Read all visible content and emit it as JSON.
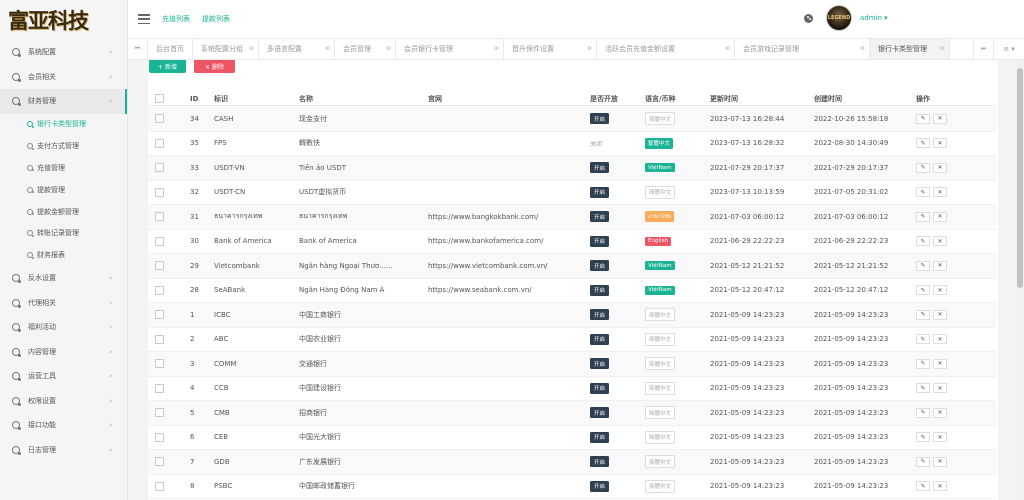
{
  "logo": {
    "text": "富亚科技"
  },
  "sidebar": {
    "items": [
      {
        "label": "系统配置",
        "open": false
      },
      {
        "label": "会员相关",
        "open": false
      },
      {
        "label": "财务管理",
        "open": true,
        "children": [
          {
            "label": "银行卡类型管理",
            "active": true
          },
          {
            "label": "支付方式管理",
            "active": false
          },
          {
            "label": "充值管理",
            "active": false
          },
          {
            "label": "提款管理",
            "active": false
          },
          {
            "label": "提款金额管理",
            "active": false
          },
          {
            "label": "转账记录管理",
            "active": false
          },
          {
            "label": "财务报表",
            "active": false
          }
        ]
      },
      {
        "label": "反水设置",
        "open": false
      },
      {
        "label": "代理相关",
        "open": false
      },
      {
        "label": "福利活动",
        "open": false
      },
      {
        "label": "内容管理",
        "open": false
      },
      {
        "label": "运营工具",
        "open": false
      },
      {
        "label": "权限设置",
        "open": false
      },
      {
        "label": "接口功能",
        "open": false
      },
      {
        "label": "日志管理",
        "open": false
      }
    ]
  },
  "header": {
    "links": [
      "充值列表",
      "提款列表"
    ],
    "user": "admin ▾",
    "avatar_text": "LEGEND"
  },
  "tabs": {
    "items": [
      {
        "label": "后台首页",
        "closable": false,
        "active": false
      },
      {
        "label": "系统配置分组",
        "closable": true,
        "active": false
      },
      {
        "label": "多语言配置",
        "closable": true,
        "active": false
      },
      {
        "label": "会员管理",
        "closable": true,
        "active": false
      },
      {
        "label": "会员银行卡管理",
        "closable": true,
        "active": false
      },
      {
        "label": "晋升保件设置",
        "closable": true,
        "active": false
      },
      {
        "label": "活跃会员充值金额设置",
        "closable": true,
        "active": false
      },
      {
        "label": "会员游戏记录管理",
        "closable": true,
        "active": false
      },
      {
        "label": "银行卡类型管理",
        "closable": true,
        "active": true
      }
    ]
  },
  "toolbar": {
    "add_label": "+ 新增",
    "delete_label": "✕ 删除"
  },
  "table": {
    "columns": [
      "ID",
      "标识",
      "名称",
      "官网",
      "是否开放",
      "语言/币种",
      "更新时间",
      "创建时间",
      "操作"
    ],
    "rows": [
      {
        "id": "34",
        "code": "CASH",
        "name": "现金支付",
        "site": "",
        "status": "开启",
        "open": true,
        "lang": "简體中文",
        "lang_style": "plain",
        "updated": "2023-07-13 16:28:44",
        "created": "2022-10-26 15:58:18"
      },
      {
        "id": "35",
        "code": "FPS",
        "name": "轉數快",
        "site": "",
        "status": "关闭",
        "open": false,
        "lang": "繁體中文",
        "lang_style": "green",
        "updated": "2023-07-13 16:28:32",
        "created": "2022-08-30 14:30:49"
      },
      {
        "id": "33",
        "code": "USDT-VN",
        "name": "Tiền ảo USDT",
        "site": "",
        "status": "开启",
        "open": true,
        "lang": "ViệtNam",
        "lang_style": "green",
        "updated": "2021-07-29 20:17:37",
        "created": "2021-07-29 20:17:37"
      },
      {
        "id": "32",
        "code": "USDT-CN",
        "name": "USDT虚拟货币",
        "site": "",
        "status": "开启",
        "open": true,
        "lang": "简體中文",
        "lang_style": "plain",
        "updated": "2023-07-13 10:13:59",
        "created": "2021-07-05 20:31:02"
      },
      {
        "id": "31",
        "code": "ธนาคารกรุงเทพ",
        "name": "ธนาคารกรุงเทพ",
        "site": "https://www.bangkokbank.com/",
        "status": "开启",
        "open": true,
        "lang": "ภาษาไทย",
        "lang_style": "orange",
        "updated": "2021-07-03 06:00:12",
        "created": "2021-07-03 06:00:12"
      },
      {
        "id": "30",
        "code": "Bank of America",
        "name": "Bank of America",
        "site": "https://www.bankofamerica.com/",
        "status": "开启",
        "open": true,
        "lang": "English",
        "lang_style": "red",
        "updated": "2021-06-29 22:22:23",
        "created": "2021-06-29 22:22:23"
      },
      {
        "id": "29",
        "code": "Vietcombank",
        "name": "Ngân hàng Ngoại Thươ......",
        "site": "https://www.vietcombank.com.vn/",
        "status": "开启",
        "open": true,
        "lang": "ViệtNam",
        "lang_style": "green",
        "updated": "2021-05-12 21:21:52",
        "created": "2021-05-12 21:21:52"
      },
      {
        "id": "28",
        "code": "SeABank",
        "name": "Ngân Hàng Đông Nam Á",
        "site": "https://www.seabank.com.vn/",
        "status": "开启",
        "open": true,
        "lang": "ViệtNam",
        "lang_style": "green",
        "updated": "2021-05-12 20:47:12",
        "created": "2021-05-12 20:47:12"
      },
      {
        "id": "1",
        "code": "ICBC",
        "name": "中国工商银行",
        "site": "",
        "status": "开启",
        "open": true,
        "lang": "简體中文",
        "lang_style": "plain",
        "updated": "2021-05-09 14:23:23",
        "created": "2021-05-09 14:23:23"
      },
      {
        "id": "2",
        "code": "ABC",
        "name": "中国农业银行",
        "site": "",
        "status": "开启",
        "open": true,
        "lang": "简體中文",
        "lang_style": "plain",
        "updated": "2021-05-09 14:23:23",
        "created": "2021-05-09 14:23:23"
      },
      {
        "id": "3",
        "code": "COMM",
        "name": "交通银行",
        "site": "",
        "status": "开启",
        "open": true,
        "lang": "简體中文",
        "lang_style": "plain",
        "updated": "2021-05-09 14:23:23",
        "created": "2021-05-09 14:23:23"
      },
      {
        "id": "4",
        "code": "CCB",
        "name": "中国建设银行",
        "site": "",
        "status": "开启",
        "open": true,
        "lang": "简體中文",
        "lang_style": "plain",
        "updated": "2021-05-09 14:23:23",
        "created": "2021-05-09 14:23:23"
      },
      {
        "id": "5",
        "code": "CMB",
        "name": "招商银行",
        "site": "",
        "status": "开启",
        "open": true,
        "lang": "简體中文",
        "lang_style": "plain",
        "updated": "2021-05-09 14:23:23",
        "created": "2021-05-09 14:23:23"
      },
      {
        "id": "6",
        "code": "CEB",
        "name": "中国光大银行",
        "site": "",
        "status": "开启",
        "open": true,
        "lang": "简體中文",
        "lang_style": "plain",
        "updated": "2021-05-09 14:23:23",
        "created": "2021-05-09 14:23:23"
      },
      {
        "id": "7",
        "code": "GDB",
        "name": "广东发展银行",
        "site": "",
        "status": "开启",
        "open": true,
        "lang": "简體中文",
        "lang_style": "plain",
        "updated": "2021-05-09 14:23:23",
        "created": "2021-05-09 14:23:23"
      },
      {
        "id": "8",
        "code": "PSBC",
        "name": "中国邮政储蓄银行",
        "site": "",
        "status": "开启",
        "open": true,
        "lang": "简體中文",
        "lang_style": "plain",
        "updated": "2021-05-09 14:23:23",
        "created": "2021-05-09 14:23:23"
      }
    ]
  }
}
